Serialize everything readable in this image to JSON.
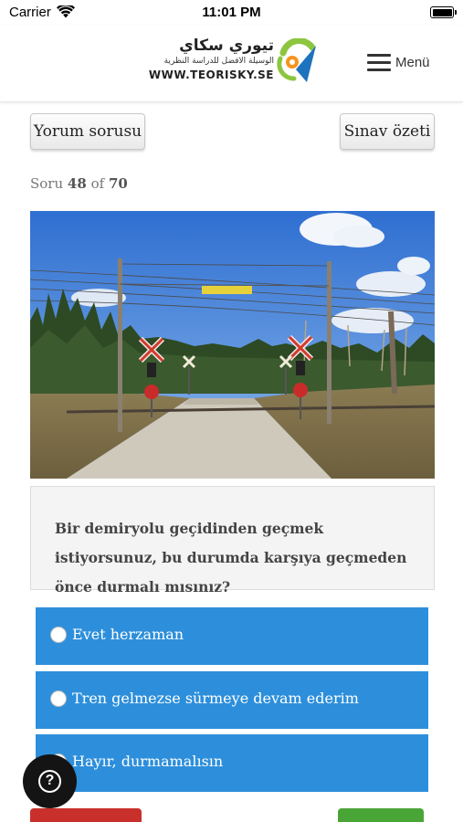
{
  "status_bar": {
    "carrier": "Carrier",
    "time": "11:01 PM"
  },
  "header": {
    "logo_arabic_title": "تيوري سكاي",
    "logo_arabic_tagline": "الوسيلة الافضل للدراسة النظرية",
    "logo_url": "WWW.TEORISKY.SE",
    "menu_label": "Menü",
    "menu_icon": "hamburger-icon",
    "logo_icon": "teorisky-logo-icon"
  },
  "toolbar": {
    "review_label": "Yorum sorusu",
    "summary_label": "Sınav özeti"
  },
  "progress": {
    "prefix": "Soru",
    "current": "48",
    "separator": "of",
    "total": "70"
  },
  "question": {
    "image": "railway-crossing-photo",
    "text": "Bir demiryolu geçidinden geçmek istiyorsunuz, bu durumda karşıya geçmeden önce durmalı mısınız?"
  },
  "answers": [
    {
      "label": "Evet herzaman"
    },
    {
      "label": "Tren gelmezse sürmeye devam ederim"
    },
    {
      "label": "Hayır, durmamalısın"
    }
  ],
  "help": {
    "icon": "question-mark-icon"
  },
  "colors": {
    "answer_bg": "#2d8fdb",
    "prev_button": "#c9302c",
    "next_button": "#4aa537",
    "logo_green": "#8cc63f",
    "logo_blue": "#1e73be",
    "logo_orange": "#f7941d"
  }
}
